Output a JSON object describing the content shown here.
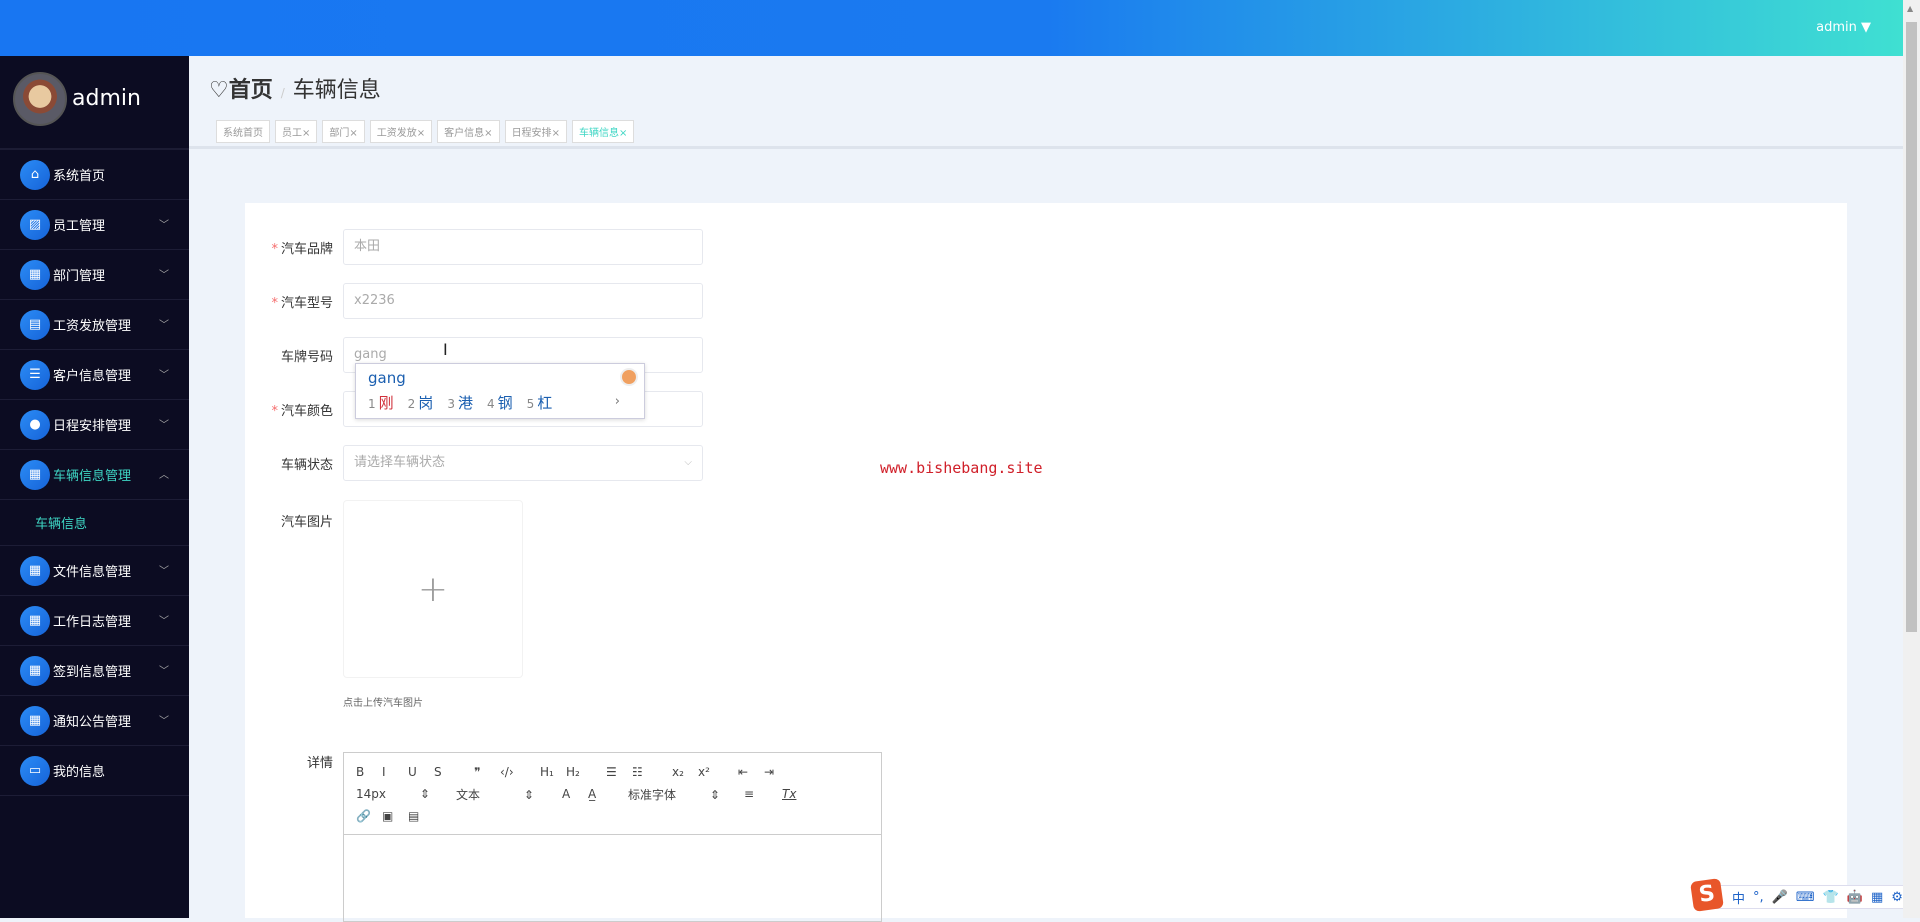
{
  "header": {
    "user": "admin",
    "dropdown_icon": "caret-down-icon"
  },
  "sidebar": {
    "username": "admin",
    "items": [
      {
        "label": "系统首页",
        "icon": "home-icon"
      },
      {
        "label": "员工管理",
        "icon": "chart-icon"
      },
      {
        "label": "部门管理",
        "icon": "grid-icon"
      },
      {
        "label": "工资发放管理",
        "icon": "clipboard-icon"
      },
      {
        "label": "客户信息管理",
        "icon": "list-icon"
      },
      {
        "label": "日程安排管理",
        "icon": "bulb-icon"
      },
      {
        "label": "车辆信息管理",
        "icon": "grid-icon",
        "active": true,
        "submenu": [
          "车辆信息"
        ]
      },
      {
        "label": "文件信息管理",
        "icon": "grid-icon"
      },
      {
        "label": "工作日志管理",
        "icon": "grid-icon"
      },
      {
        "label": "签到信息管理",
        "icon": "grid-icon"
      },
      {
        "label": "通知公告管理",
        "icon": "grid-icon"
      },
      {
        "label": "我的信息",
        "icon": "card-icon"
      }
    ]
  },
  "breadcrumb": {
    "home": "首页",
    "separator": "/",
    "current": "车辆信息"
  },
  "tags": [
    {
      "label": "系统首页",
      "closable": false
    },
    {
      "label": "员工",
      "closable": true
    },
    {
      "label": "部门",
      "closable": true
    },
    {
      "label": "工资发放",
      "closable": true
    },
    {
      "label": "客户信息",
      "closable": true
    },
    {
      "label": "日程安排",
      "closable": true
    },
    {
      "label": "车辆信息",
      "closable": true,
      "active": true
    }
  ],
  "form": {
    "brand": {
      "label": "汽车品牌",
      "required": true,
      "value": "本田"
    },
    "model": {
      "label": "汽车型号",
      "required": true,
      "value": "x2236"
    },
    "plate": {
      "label": "车牌号码",
      "required": false,
      "value": "gang"
    },
    "color": {
      "label": "汽车颜色",
      "required": true,
      "value": ""
    },
    "status": {
      "label": "车辆状态",
      "placeholder": "请选择车辆状态"
    },
    "image": {
      "label": "汽车图片",
      "hint": "点击上传汽车图片"
    },
    "detail": {
      "label": "详情"
    }
  },
  "editor": {
    "row1": [
      "B",
      "I",
      "U",
      "S",
      "❞",
      "‹/›",
      "H₁",
      "H₂",
      "☰",
      "☷",
      "x₂",
      "x²",
      "⇤",
      "⇥"
    ],
    "font_size": "14px",
    "block": "文本",
    "font_family": "标准字体",
    "row2_icons": [
      "A",
      "A̲",
      "≡",
      "Tx"
    ],
    "row3": [
      "🔗",
      "▣",
      "▤"
    ]
  },
  "ime": {
    "pinyin": "gang",
    "candidates": [
      "刚",
      "岗",
      "港",
      "钢",
      "杠"
    ],
    "more": "›"
  },
  "watermark": "www.bishebang.site",
  "imebar": {
    "logo": "S",
    "items": [
      "中",
      "°,",
      "🎤",
      "⌨",
      "👕",
      "🤖",
      "▦",
      "⚙"
    ]
  }
}
